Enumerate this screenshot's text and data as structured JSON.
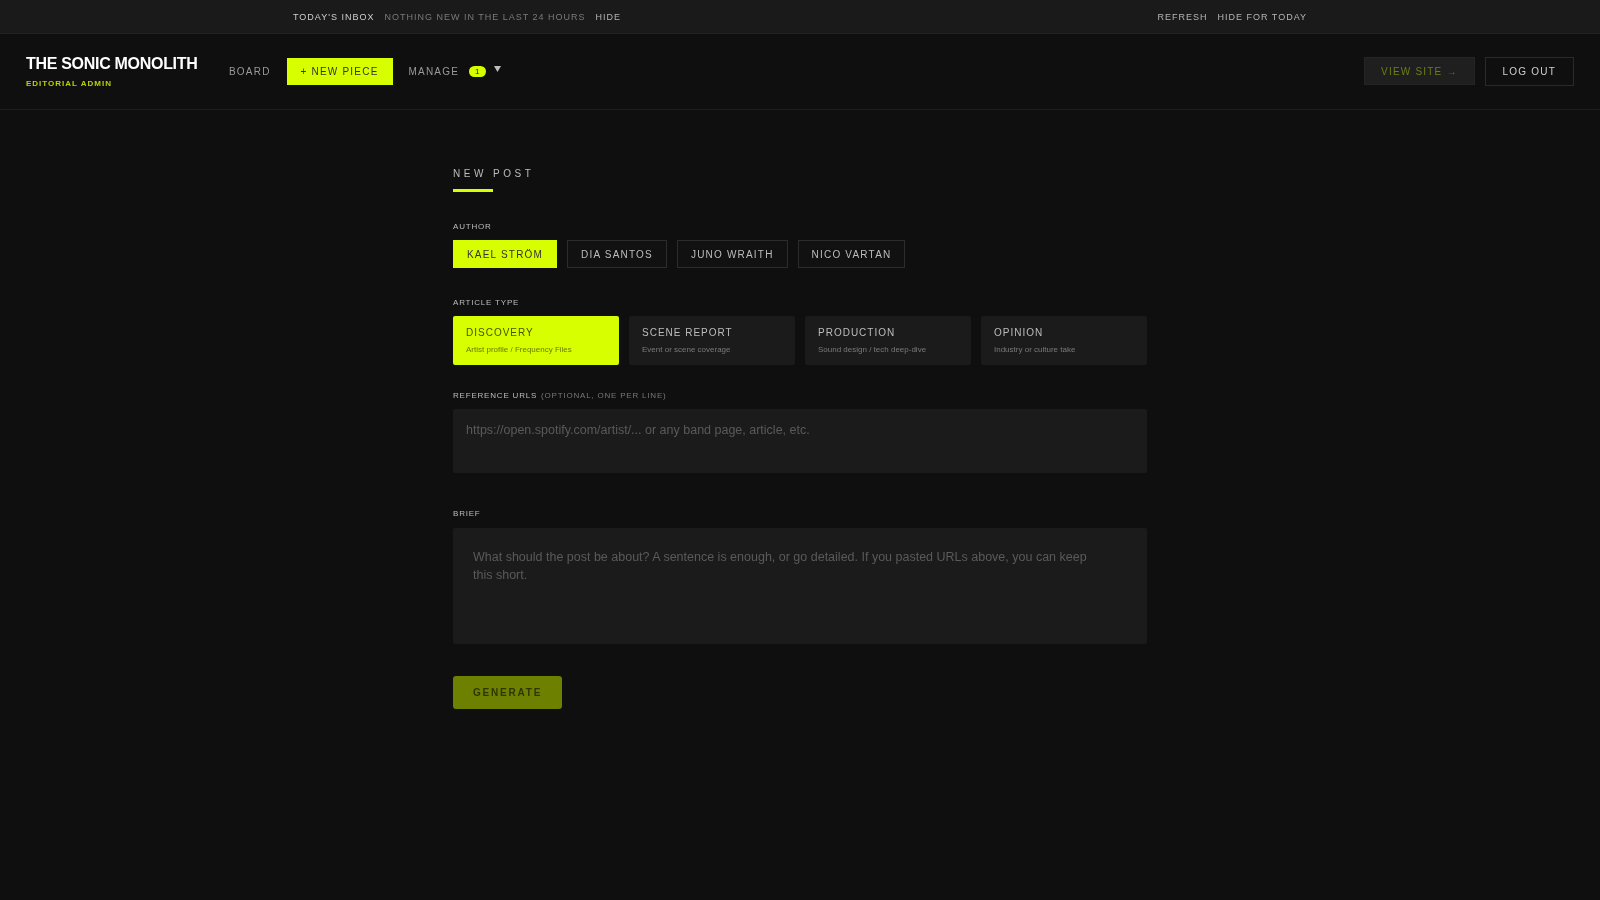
{
  "inbox_bar": {
    "title": "TODAY'S INBOX",
    "message": "NOTHING NEW IN THE LAST 24 HOURS",
    "hide": "HIDE",
    "refresh": "REFRESH",
    "hide_today": "HIDE FOR TODAY"
  },
  "header": {
    "brand": "THE SONIC MONOLITH",
    "subtitle": "EDITORIAL ADMIN",
    "nav": [
      {
        "label": "BOARD",
        "kind": "link"
      },
      {
        "label": "+ NEW PIECE",
        "kind": "primary"
      },
      {
        "label": "MANAGE",
        "kind": "menu",
        "badge": "1"
      }
    ],
    "view_site": "VIEW SITE →",
    "log_out": "LOG OUT"
  },
  "form": {
    "title": "NEW POST",
    "author_label": "AUTHOR",
    "authors": [
      {
        "label": "KAEL STRÖM",
        "selected": true
      },
      {
        "label": "DIA SANTOS",
        "selected": false
      },
      {
        "label": "JUNO WRAITH",
        "selected": false
      },
      {
        "label": "NICO VARTAN",
        "selected": false
      }
    ],
    "type_label": "ARTICLE TYPE",
    "types": [
      {
        "label": "DISCOVERY",
        "description": "Artist profile / Frequency Files",
        "selected": true
      },
      {
        "label": "SCENE REPORT",
        "description": "Event or scene coverage",
        "selected": false
      },
      {
        "label": "PRODUCTION",
        "description": "Sound design / tech deep-dive",
        "selected": false
      },
      {
        "label": "OPINION",
        "description": "Industry or culture take",
        "selected": false
      }
    ],
    "urls_label": "REFERENCE URLS",
    "urls_hint": "(OPTIONAL, ONE PER LINE)",
    "urls_placeholder": "https://open.spotify.com/artist/... or any band page, article, etc.",
    "brief_label": "BRIEF",
    "brief_placeholder": "What should the post be about? A sentence is enough, or go detailed. If you pasted URLs above, you can keep this short.",
    "generate": {
      "label": "GENERATE",
      "disabled": true
    }
  }
}
